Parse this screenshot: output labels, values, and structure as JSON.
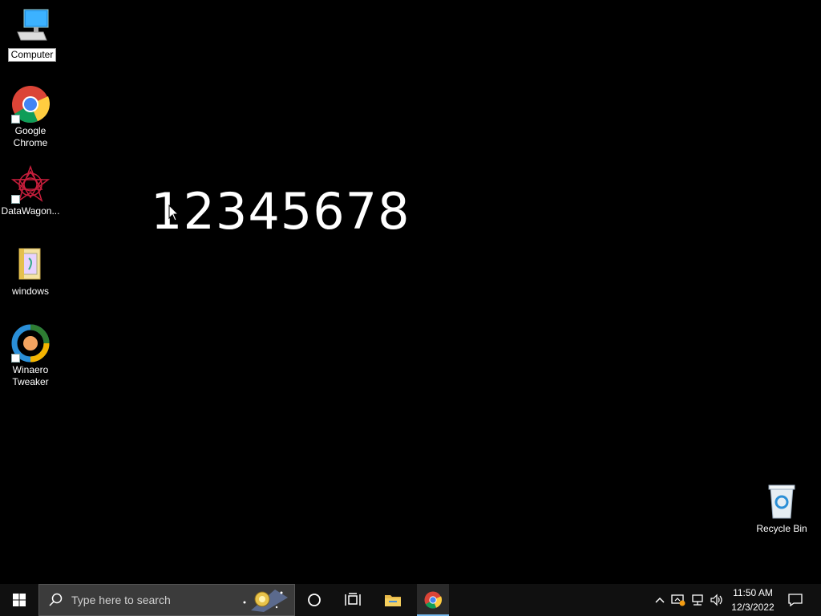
{
  "desktop": {
    "icons": [
      {
        "label": "Computer",
        "icon": "computer-icon"
      },
      {
        "label": "Google Chrome",
        "icon": "chrome-icon"
      },
      {
        "label": "DataWagon...",
        "icon": "datawagon-icon"
      },
      {
        "label": "windows",
        "icon": "folder-icon"
      },
      {
        "label": "Winaero Tweaker",
        "icon": "winaero-tweaker-icon"
      },
      {
        "label": "Recycle Bin",
        "icon": "recycle-bin-icon"
      }
    ],
    "big_text": "12345678"
  },
  "taskbar": {
    "search_placeholder": "Type here to search",
    "clock_time": "11:50 AM",
    "clock_date": "12/3/2022",
    "pinned": [
      "start-icon",
      "cortana-icon",
      "task-view-icon",
      "file-explorer-icon",
      "chrome-icon"
    ],
    "tray": [
      "show-hidden-icons-chevron",
      "network-security-icon",
      "network-icon",
      "volume-icon",
      "notification-icon"
    ]
  },
  "colors": {
    "desktop_bg": "#000000",
    "taskbar_bg": "#101010",
    "search_bg": "#3b3b3b",
    "active_accent": "#76b9ed"
  }
}
